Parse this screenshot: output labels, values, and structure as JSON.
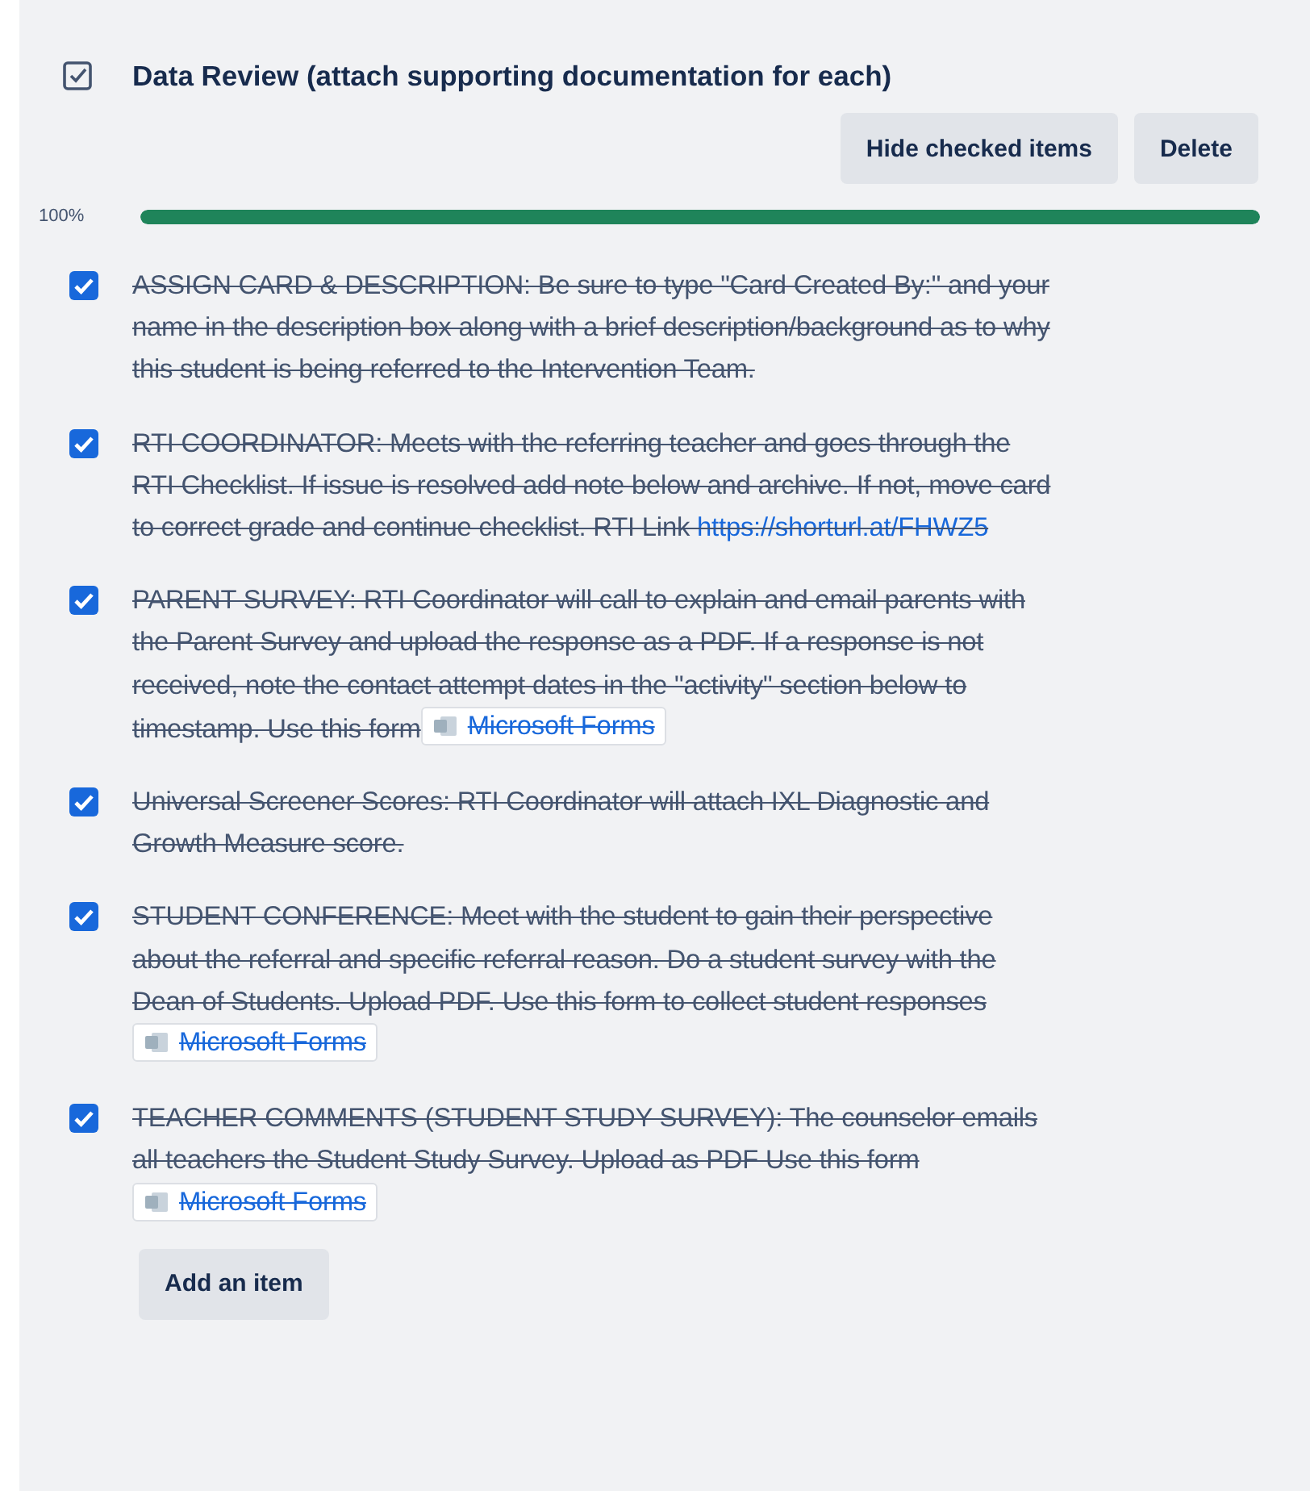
{
  "checklist": {
    "title": "Data Review (attach supporting documentation for each)",
    "checked": true,
    "actions": [
      "Hide checked items",
      "Delete"
    ],
    "progress": {
      "reading": "100%",
      "level": 1
    },
    "items": [
      {
        "checked": true,
        "parts": [
          {
            "kind": "text",
            "text": "ASSIGN CARD & DESCRIPTION: Be sure to type \"Card Created By:\" and your name in the description box along with a brief description/background as to why this student is being referred to the Intervention Team."
          }
        ]
      },
      {
        "checked": true,
        "parts": [
          {
            "kind": "text",
            "text": "RTI COORDINATOR: Meets with the referring teacher and goes through the RTI Checklist. If issue is resolved add note below and archive. If not, move card to correct grade and continue checklist. RTI Link "
          },
          {
            "kind": "link",
            "text": "https://shorturl.at/FHWZ5"
          }
        ]
      },
      {
        "checked": true,
        "parts": [
          {
            "kind": "text",
            "text": "PARENT SURVEY: RTI Coordinator will call to explain and email parents with the Parent Survey and upload the response as a PDF. If a response is not received, note the contact attempt dates in the \"activity\" section below to timestamp. Use this form"
          },
          {
            "kind": "chip",
            "text": "Microsoft Forms"
          }
        ]
      },
      {
        "checked": true,
        "parts": [
          {
            "kind": "text",
            "text": "Universal Screener Scores: RTI Coordinator will attach IXL Diagnostic and Growth Measure score."
          }
        ]
      },
      {
        "checked": true,
        "parts": [
          {
            "kind": "text",
            "text": "STUDENT CONFERENCE: Meet with the student to gain their perspective about the referral and specific referral reason. Do a student survey with the Dean of Students. Upload PDF. Use this form to collect student responses "
          },
          {
            "kind": "chip",
            "text": "Microsoft Forms"
          }
        ]
      },
      {
        "checked": true,
        "parts": [
          {
            "kind": "text",
            "text": "TEACHER COMMENTS (STUDENT STUDY SURVEY): The counselor emails all teachers the Student Study Survey. Upload as PDF Use this form "
          },
          {
            "kind": "chip",
            "text": "Microsoft Forms"
          }
        ]
      }
    ],
    "add_button": "Add an item"
  }
}
